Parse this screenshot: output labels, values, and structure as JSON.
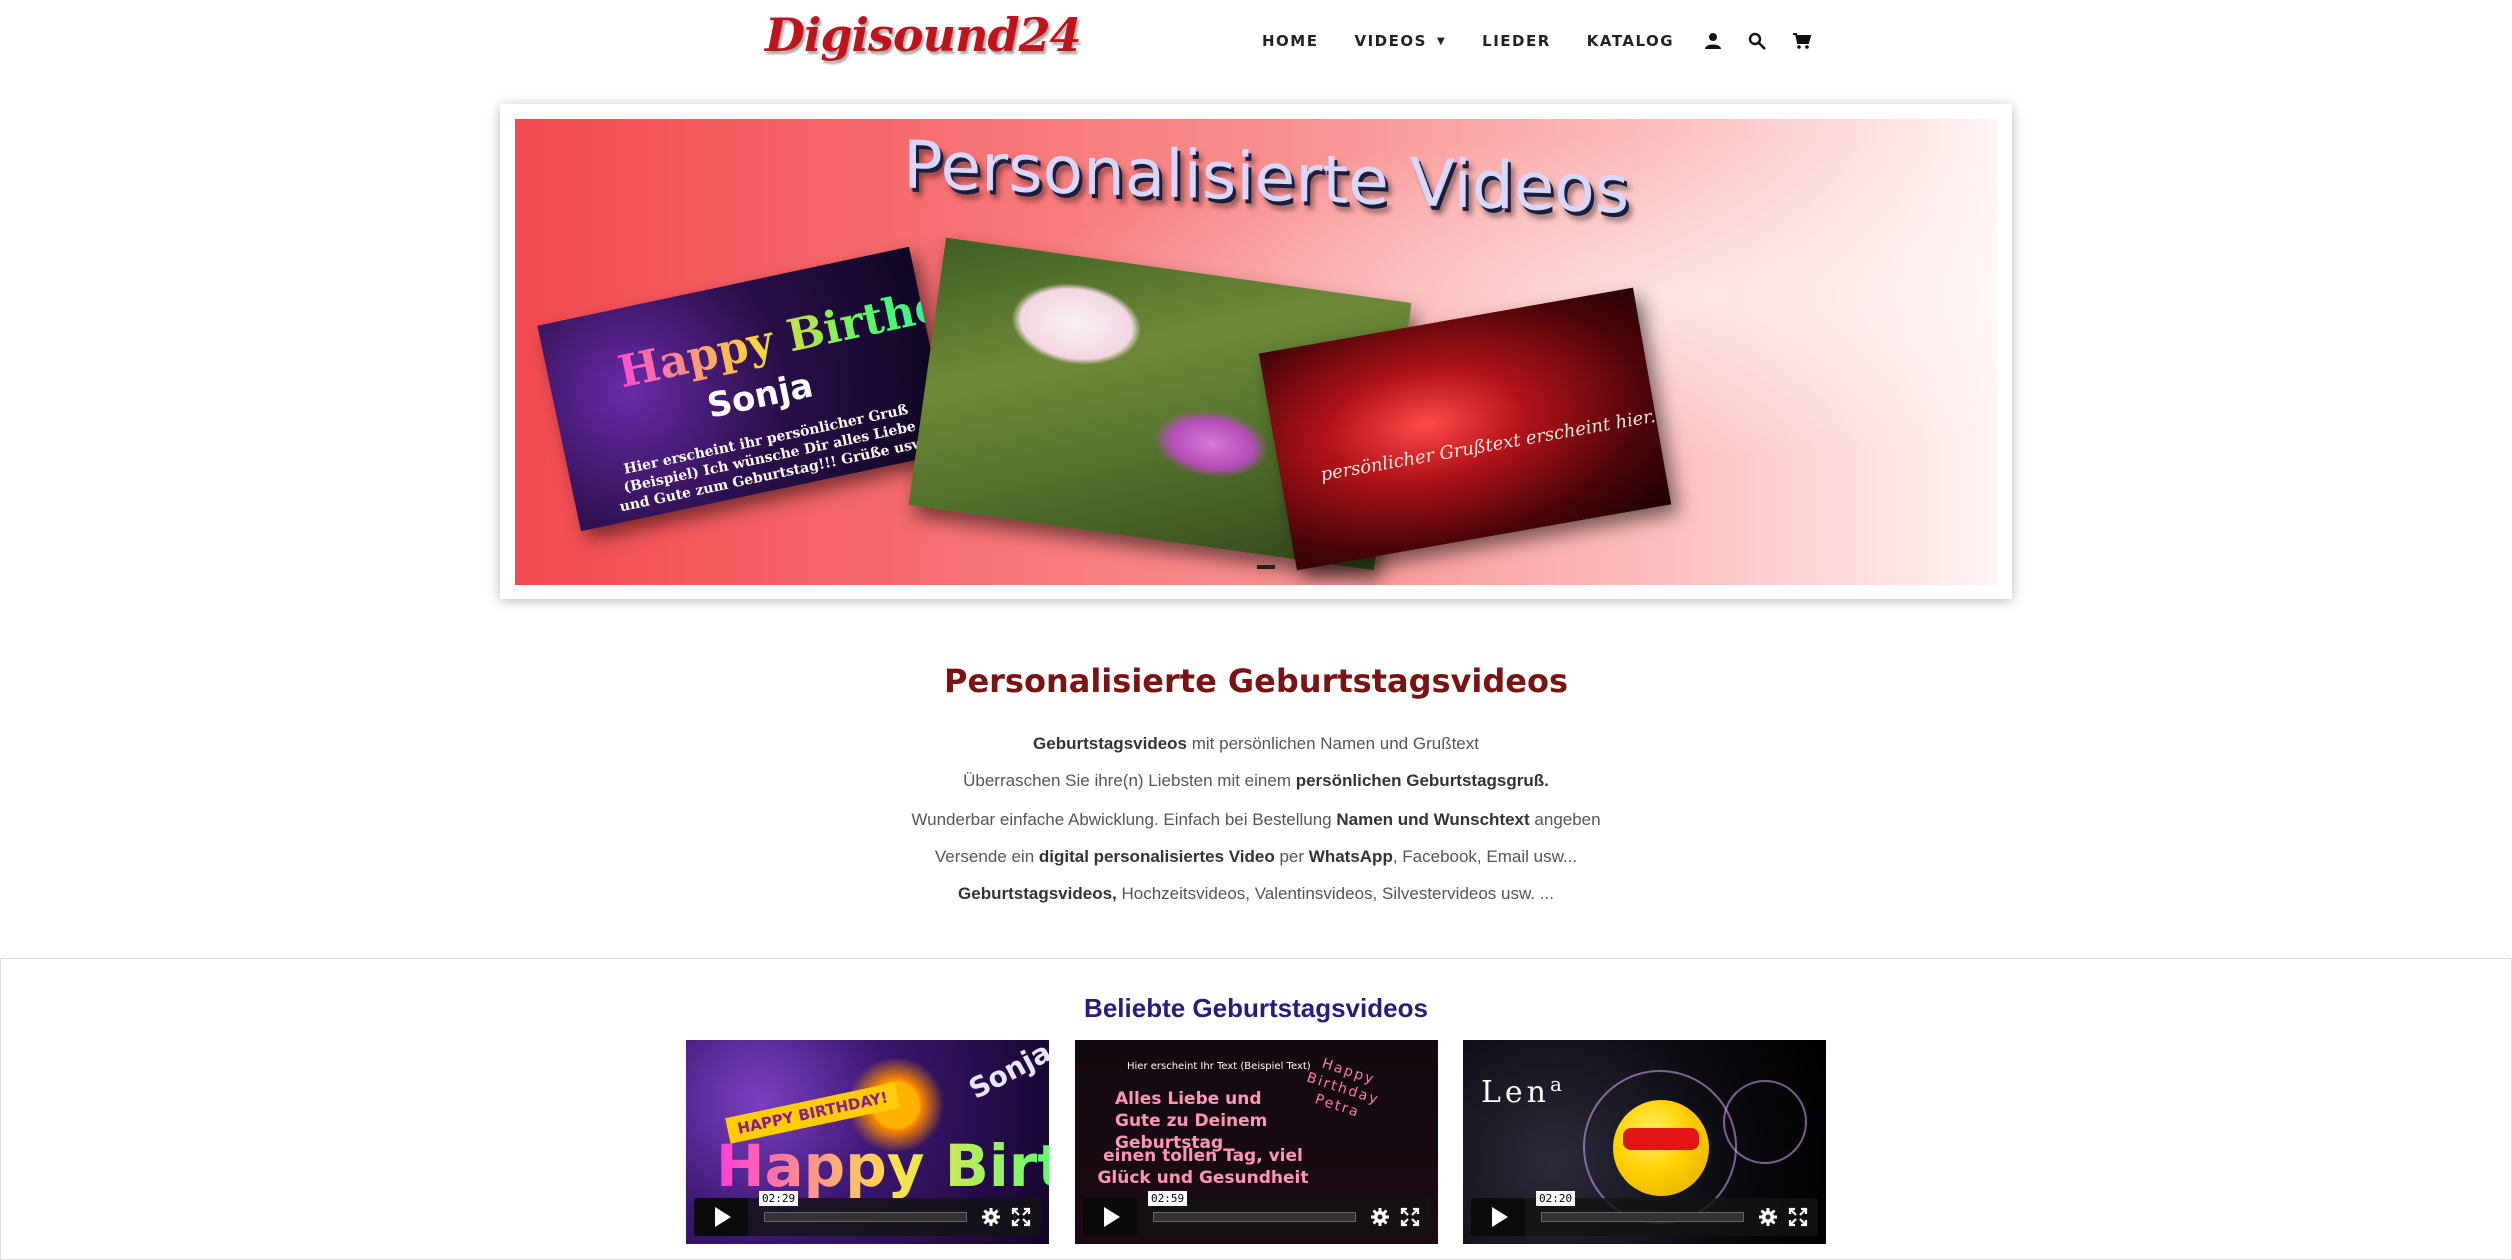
{
  "header": {
    "logo_text": "Digisound24",
    "nav": [
      {
        "label": "HOME"
      },
      {
        "label": "VIDEOS",
        "has_dropdown": true
      },
      {
        "label": "LIEDER"
      },
      {
        "label": "KATALOG"
      }
    ],
    "icons": [
      "account-icon",
      "search-icon",
      "cart-icon"
    ]
  },
  "hero": {
    "title": "Personalisierte Videos",
    "card_bday_title": "Happy Birthday!",
    "card_bday_name": "Sonja",
    "card_bday_text": "Hier erscheint ihr persönlicher Gruß (Beispiel) Ich wünsche Dir alles Liebe und Gute zum Geburtstag!!! Grüße usw. ...",
    "card_heart_text": "persönlicher Grußtext erscheint hier....",
    "active_slide": 1,
    "slide_count": 1
  },
  "intro": {
    "heading": "Personalisierte Geburtstagsvideos",
    "lines": [
      {
        "bold_a": "Geburtstagsvideos",
        "text_a": " mit persönlichen Namen und Grußtext"
      },
      {
        "text_a": "Überraschen Sie ihre(n) Liebsten mit einem ",
        "bold_a": "persönlichen Geburtstagsgruß."
      },
      {
        "text_a": "Wunderbar einfache Abwicklung.  Einfach bei Bestellung ",
        "bold_a": "Namen und Wunschtext",
        "text_b": " angeben"
      },
      {
        "text_a": "Versende ein ",
        "bold_a": "digital personalisiertes Video",
        "text_b": " per ",
        "bold_b": "WhatsApp",
        "text_c": ", Facebook, Email usw..."
      },
      {
        "bold_a": "Geburtstagsvideos,",
        "text_a": " Hochzeitsvideos, Valentinsvideos, Silvestervideos usw. ..."
      }
    ]
  },
  "popular": {
    "heading": "Beliebte Geburtstagsvideos",
    "videos": [
      {
        "duration": "02:29",
        "name_text": "Sonja",
        "badge_text": "HAPPY BIRTHDAY!",
        "big_text": "Happy Birthday!"
      },
      {
        "duration": "02:59",
        "small_text": "Hier erscheint Ihr Text (Beispiel Text)",
        "hb_text": "Happy Birthday Petra",
        "main_text": "Alles Liebe und Gute zu Deinem Geburtstag",
        "main_text2": "einen tollen Tag, viel Glück und Gesundheit"
      },
      {
        "duration": "02:20",
        "name_text": "Len",
        "name_sup": "a"
      }
    ]
  },
  "colors": {
    "logo": "#c0141c",
    "intro_heading": "#7a1414",
    "popular_heading": "#2b1b7a"
  }
}
